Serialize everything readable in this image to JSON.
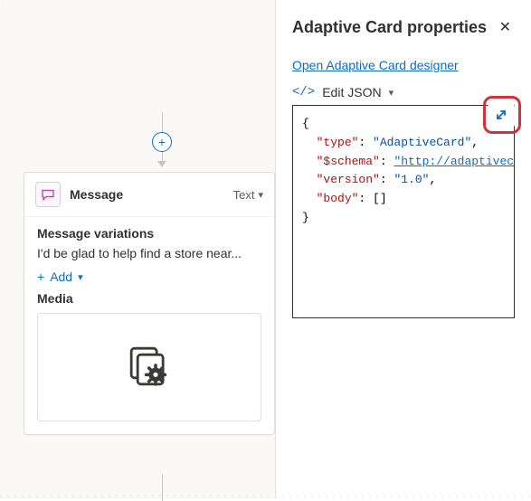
{
  "canvas": {
    "add_plus": "+",
    "message_card": {
      "title": "Message",
      "type_label": "Text",
      "variations_title": "Message variations",
      "variation_sample": "I'd be glad to help find a store near...",
      "add_label": "Add",
      "media_title": "Media"
    }
  },
  "panel": {
    "title": "Adaptive Card properties",
    "open_designer_link": "Open Adaptive Card designer",
    "edit_json_label": "Edit JSON",
    "code_glyph": "</>",
    "json_lines": {
      "l1": "{",
      "l2_key": "\"type\"",
      "l2_val": "\"AdaptiveCard\"",
      "l3_key": "\"$schema\"",
      "l3_val_disp": "\"http://adaptivecards.i",
      "l4_key": "\"version\"",
      "l4_val": "\"1.0\"",
      "l5_key": "\"body\"",
      "l5_val": "[]",
      "l6": "}"
    }
  }
}
